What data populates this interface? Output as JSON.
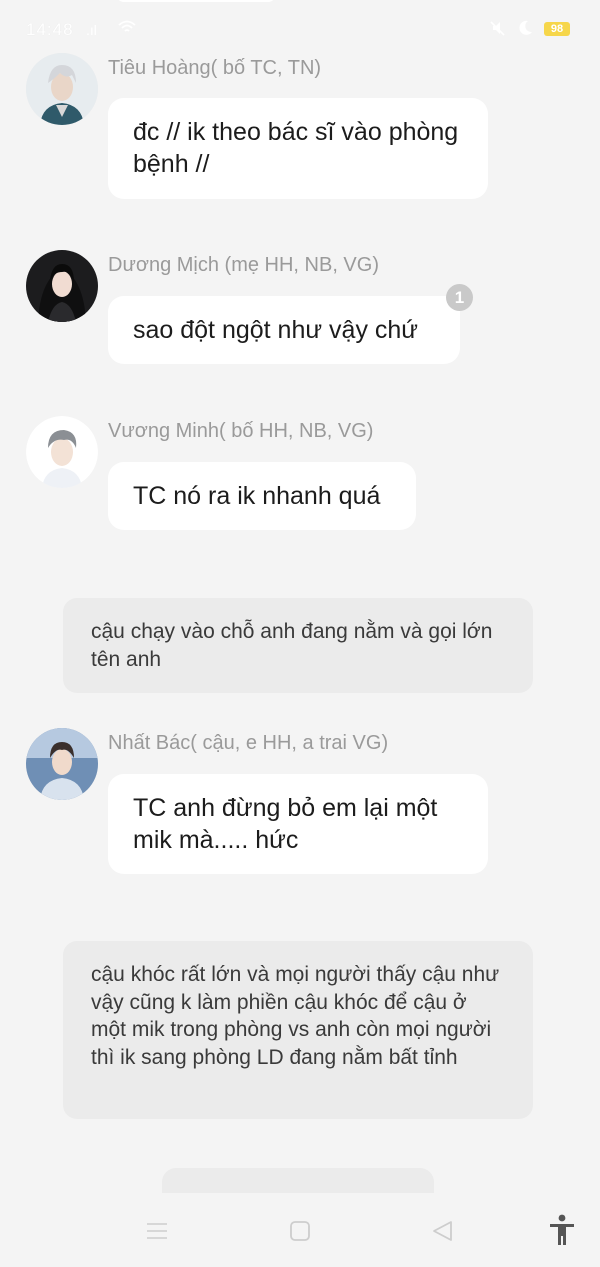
{
  "status_bar": {
    "time": "14:48",
    "signal": ".ıl",
    "battery": "98"
  },
  "messages": [
    {
      "sender": "Tiêu Hoàng( bố TC, TN)",
      "text": "đc // ik theo bác sĩ vào phòng bệnh //"
    },
    {
      "sender": "Dương Mịch (mẹ HH, NB, VG)",
      "text": "sao đột ngột như vậy chứ",
      "badge": "1"
    },
    {
      "sender": "Vương Minh( bố HH, NB, VG)",
      "text": "TC nó ra ik nhanh quá"
    },
    {
      "sender": "Nhất Bác( cậu, e HH, a trai VG)",
      "text": "TC anh đừng bỏ em lại một mik mà..... hức"
    }
  ],
  "narrations": [
    "cậu chạy vào chỗ anh đang nằm và gọi lớn tên anh",
    "cậu khóc rất lớn và mọi người thấy cậu như vậy cũng k làm phiền cậu khóc để cậu ở một mik trong phòng vs anh còn mọi người thì ik sang phòng LD đang nằm bất tỉnh"
  ],
  "icons": {
    "nav_menu": "menu-icon",
    "nav_home": "home-square-icon",
    "nav_back": "back-triangle-icon",
    "accessibility": "accessibility-icon"
  },
  "colors": {
    "background": "#f4f4f4",
    "bubble": "#ffffff",
    "narration": "#ebebeb",
    "sender_name": "#9a9a9a",
    "battery": "#f6d64a"
  }
}
